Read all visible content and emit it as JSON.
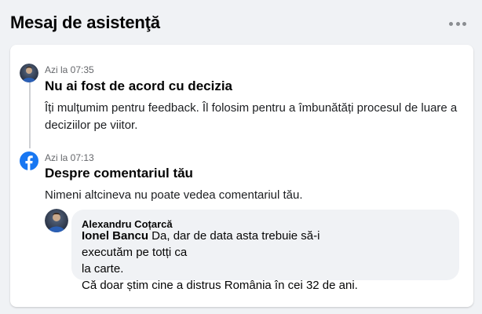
{
  "header": {
    "title": "Mesaj de asistenţă",
    "more_icon": "more-horizontal-icon"
  },
  "messages": [
    {
      "time": "Azi la 07:35",
      "title": "Nu ai fost de acord cu decizia",
      "body_line1": "Îți mulțumim pentru feedback. Îl folosim pentru a îmbunătăți procesul de luare a",
      "body_line2": "deciziilor pe viitor.",
      "icon": "user-avatar"
    },
    {
      "time": "Azi la 07:13",
      "title": "Despre comentariul tău",
      "body": "Nimeni altcineva nu poate vedea comentariul tău.",
      "icon": "facebook-logo-icon"
    }
  ],
  "comment": {
    "author": "Alexandru Coțarcă",
    "mention": "Ionel Bancu",
    "line1_rest": " Da, dar de data asta trebuie să-i executăm pe totți ca",
    "line2": "la carte.",
    "line3": "Că doar știm cine a distrus România în cei 32 de ani."
  },
  "colors": {
    "background": "#f0f2f5",
    "card": "#ffffff",
    "facebook_blue": "#1877f2",
    "secondary_text": "#65676b"
  }
}
